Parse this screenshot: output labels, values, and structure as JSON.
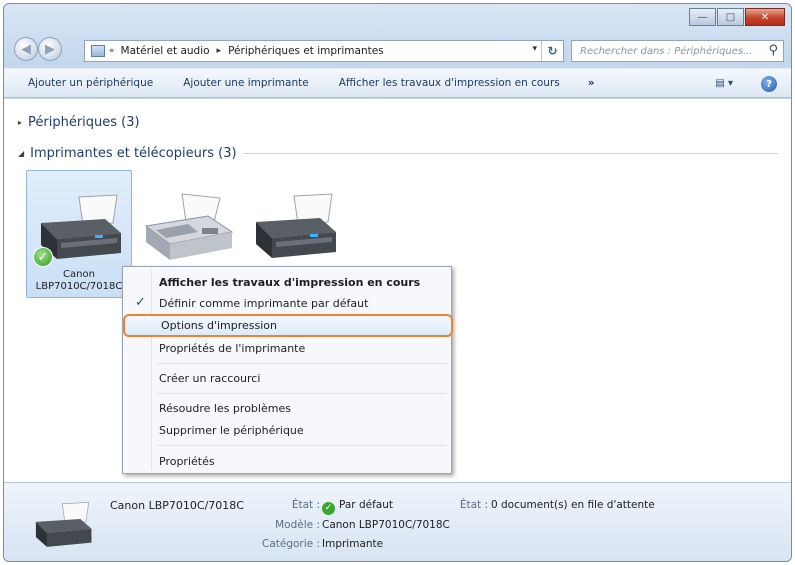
{
  "window": {
    "controls": {
      "minimize": "—",
      "maximize": "□",
      "close": "✕"
    }
  },
  "nav": {
    "back": "◀",
    "forward": "▶"
  },
  "address": {
    "prefix": "«",
    "crumbs": [
      "Matériel et audio",
      "Périphériques et imprimantes"
    ],
    "separator": "▸",
    "dropdown": "▾",
    "refresh": "↻"
  },
  "search": {
    "placeholder": "Rechercher dans : Périphériques...",
    "icon": "⚲"
  },
  "toolbar": {
    "add_device": "Ajouter un périphérique",
    "add_printer": "Ajouter une imprimante",
    "see_print_jobs": "Afficher les travaux d'impression en cours",
    "more": "»",
    "views": "▤ ▾",
    "help": "?"
  },
  "groups": {
    "devices": {
      "toggle": "▸",
      "title": "Périphériques (3)"
    },
    "printers": {
      "toggle": "◢",
      "title": "Imprimantes et télécopieurs (3)"
    }
  },
  "printers": [
    {
      "name_line1": "Canon",
      "name_line2": "LBP7010C/7018C",
      "selected": true,
      "default_check": "✓"
    },
    {
      "name_line1": "",
      "name_line2": ""
    },
    {
      "name_line1": "",
      "name_line2": ""
    }
  ],
  "context_menu": {
    "items": [
      {
        "label": "Afficher les travaux d'impression en cours"
      },
      {
        "label": "Définir comme imprimante par défaut",
        "check": "✓"
      },
      {
        "label": "Options d'impression"
      },
      {
        "label": "Propriétés de l'imprimante"
      },
      {
        "label": "Créer un raccourci"
      },
      {
        "label": "Résoudre les problèmes"
      },
      {
        "label": "Supprimer le périphérique"
      },
      {
        "label": "Propriétés"
      }
    ]
  },
  "details": {
    "name": "Canon LBP7010C/7018C",
    "state_label": "État :",
    "state_value": "Par défaut",
    "state_check": "✓",
    "queue_label": "État :",
    "queue_value": "0 document(s) en file d'attente",
    "model_label": "Modèle :",
    "model_value": "Canon LBP7010C/7018C",
    "category_label": "Catégorie :",
    "category_value": "Imprimante"
  }
}
